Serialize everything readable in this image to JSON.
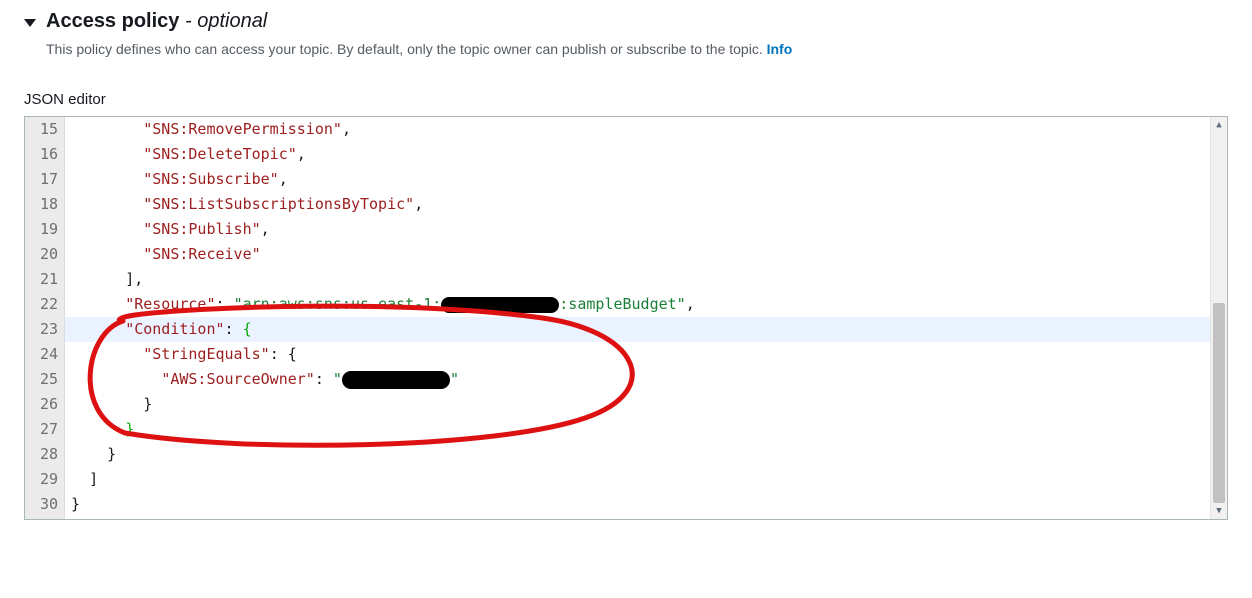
{
  "header": {
    "title_main": "Access policy",
    "title_suffix": " - optional",
    "description": "This policy defines who can access your topic. By default, only the topic owner can publish or subscribe to the topic. ",
    "info_link": "Info"
  },
  "editor": {
    "label": "JSON editor",
    "first_line_number": 15,
    "lines": [
      {
        "n": 15,
        "indent": 8,
        "tokens": [
          {
            "t": "\"SNS:RemovePermission\"",
            "c": "k"
          },
          {
            "t": ",",
            "c": "p"
          }
        ]
      },
      {
        "n": 16,
        "indent": 8,
        "tokens": [
          {
            "t": "\"SNS:DeleteTopic\"",
            "c": "k"
          },
          {
            "t": ",",
            "c": "p"
          }
        ]
      },
      {
        "n": 17,
        "indent": 8,
        "tokens": [
          {
            "t": "\"SNS:Subscribe\"",
            "c": "k"
          },
          {
            "t": ",",
            "c": "p"
          }
        ]
      },
      {
        "n": 18,
        "indent": 8,
        "tokens": [
          {
            "t": "\"SNS:ListSubscriptionsByTopic\"",
            "c": "k"
          },
          {
            "t": ",",
            "c": "p"
          }
        ]
      },
      {
        "n": 19,
        "indent": 8,
        "tokens": [
          {
            "t": "\"SNS:Publish\"",
            "c": "k"
          },
          {
            "t": ",",
            "c": "p"
          }
        ]
      },
      {
        "n": 20,
        "indent": 8,
        "tokens": [
          {
            "t": "\"SNS:Receive\"",
            "c": "k"
          }
        ]
      },
      {
        "n": 21,
        "indent": 6,
        "tokens": [
          {
            "t": "],",
            "c": "p"
          }
        ]
      },
      {
        "n": 22,
        "indent": 6,
        "tokens": [
          {
            "t": "\"Resource\"",
            "c": "k"
          },
          {
            "t": ": ",
            "c": "p"
          },
          {
            "t": "\"arn:aws:sns:us-east-1:",
            "c": "s"
          },
          {
            "t": "REDACT",
            "w": 118,
            "h": 16
          },
          {
            "t": ":sampleBudget\"",
            "c": "s"
          },
          {
            "t": ",",
            "c": "p"
          }
        ]
      },
      {
        "n": 23,
        "indent": 6,
        "hl": true,
        "tokens": [
          {
            "t": "\"Condition\"",
            "c": "k"
          },
          {
            "t": ": ",
            "c": "p"
          },
          {
            "t": "{",
            "c": "br"
          }
        ]
      },
      {
        "n": 24,
        "indent": 8,
        "tokens": [
          {
            "t": "\"StringEquals\"",
            "c": "k"
          },
          {
            "t": ": ",
            "c": "p"
          },
          {
            "t": "{",
            "c": "p"
          }
        ]
      },
      {
        "n": 25,
        "indent": 10,
        "tokens": [
          {
            "t": "\"AWS:SourceOwner\"",
            "c": "k"
          },
          {
            "t": ": ",
            "c": "p"
          },
          {
            "t": "\"",
            "c": "s"
          },
          {
            "t": "REDACT",
            "w": 108,
            "h": 18
          },
          {
            "t": "\"",
            "c": "s"
          }
        ]
      },
      {
        "n": 26,
        "indent": 8,
        "tokens": [
          {
            "t": "}",
            "c": "p"
          }
        ]
      },
      {
        "n": 27,
        "indent": 6,
        "tokens": [
          {
            "t": "}",
            "c": "br"
          }
        ]
      },
      {
        "n": 28,
        "indent": 4,
        "tokens": [
          {
            "t": "}",
            "c": "p"
          }
        ]
      },
      {
        "n": 29,
        "indent": 2,
        "tokens": [
          {
            "t": "]",
            "c": "p"
          }
        ]
      },
      {
        "n": 30,
        "indent": 0,
        "tokens": [
          {
            "t": "}",
            "c": "p"
          }
        ]
      }
    ]
  },
  "annotation": {
    "color": "#d22",
    "stroke_width": 5
  }
}
